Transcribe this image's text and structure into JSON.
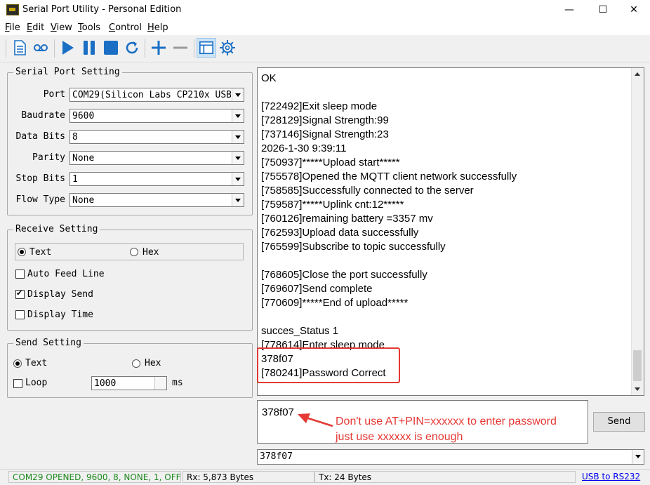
{
  "window": {
    "title": "Serial Port Utility - Personal Edition",
    "minimize_glyph": "—",
    "maximize_glyph": "☐",
    "close_glyph": "✕"
  },
  "menu": [
    {
      "label": "File",
      "key": "F"
    },
    {
      "label": "Edit",
      "key": "E"
    },
    {
      "label": "View",
      "key": "V"
    },
    {
      "label": "Tools",
      "key": "T"
    },
    {
      "label": "Control",
      "key": "C"
    },
    {
      "label": "Help",
      "key": "H"
    }
  ],
  "toolbar": {
    "icons": [
      "document-icon",
      "cassette-icon",
      "play-icon",
      "pause-icon",
      "stop-icon",
      "refresh-icon",
      "plus-icon",
      "minus-icon",
      "window-icon",
      "gear-icon"
    ],
    "accent": "#1a6fc4"
  },
  "serial_port_setting": {
    "title": "Serial Port Setting",
    "fields": [
      {
        "label": "Port",
        "value": "COM29(Silicon Labs CP210x USB"
      },
      {
        "label": "Baudrate",
        "value": "9600"
      },
      {
        "label": "Data Bits",
        "value": "8"
      },
      {
        "label": "Parity",
        "value": "None"
      },
      {
        "label": "Stop Bits",
        "value": "1"
      },
      {
        "label": "Flow Type",
        "value": "None"
      }
    ]
  },
  "receive_setting": {
    "title": "Receive Setting",
    "radio_text": "Text",
    "radio_hex": "Hex",
    "selected": "Text",
    "auto_feed_line": {
      "label": "Auto Feed Line",
      "checked": false
    },
    "display_send": {
      "label": "Display Send",
      "checked": true
    },
    "display_time": {
      "label": "Display Time",
      "checked": false
    }
  },
  "send_setting": {
    "title": "Send Setting",
    "radio_text": "Text",
    "radio_hex": "Hex",
    "selected": "Text",
    "loop": {
      "label": "Loop",
      "checked": false
    },
    "interval": "1000",
    "unit": "ms"
  },
  "receive_lines": [
    "OK",
    "",
    "[722492]Exit sleep mode",
    "[728129]Signal Strength:99",
    "[737146]Signal Strength:23",
    "2026-1-30 9:39:11",
    "[750937]*****Upload start*****",
    "[755578]Opened the MQTT client network successfully",
    "[758585]Successfully connected to the server",
    "[759587]*****Uplink cnt:12*****",
    "[760126]remaining battery =3357 mv",
    "[762593]Upload data successfully",
    "[765599]Subscribe to topic successfully",
    "",
    "[768605]Close the port successfully",
    "[769607]Send complete",
    "[770609]*****End of upload*****",
    "",
    "succes_Status 1",
    "[778614]Enter sleep mode",
    "378f07",
    "[780241]Password Correct"
  ],
  "send": {
    "text": "378f07",
    "button": "Send",
    "history_value": "378f07"
  },
  "annotation": {
    "line1": "Don't use AT+PIN=xxxxxx to enter password",
    "line2": "just use xxxxxx is enough",
    "color": "#e53935"
  },
  "status": {
    "port": "COM29 OPENED, 9600, 8, NONE, 1, OFF",
    "rx": "Rx: 5,873 Bytes",
    "tx": "Tx: 24 Bytes",
    "link": "USB to RS232",
    "port_color": "#1e8a1e"
  }
}
